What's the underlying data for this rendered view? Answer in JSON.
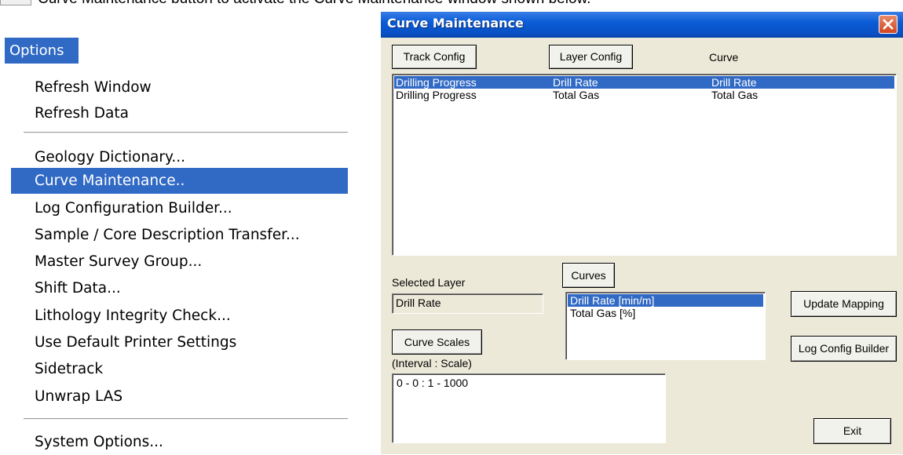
{
  "caption": {
    "text": "Curve Maintenance button to activate the Curve Maintenance window shown below."
  },
  "menu": {
    "title": "Options",
    "items": [
      {
        "label": "Refresh Window"
      },
      {
        "label": "Refresh Data"
      },
      {
        "label": "Geology Dictionary..."
      },
      {
        "label": "Curve Maintenance..",
        "selected": true
      },
      {
        "label": "Log Configuration Builder..."
      },
      {
        "label": "Sample / Core Description Transfer..."
      },
      {
        "label": "Master Survey Group..."
      },
      {
        "label": "Shift Data..."
      },
      {
        "label": "Lithology Integrity Check..."
      },
      {
        "label": "Use Default Printer Settings"
      },
      {
        "label": "Sidetrack"
      },
      {
        "label": "Unwrap LAS"
      },
      {
        "label": "System Options..."
      }
    ]
  },
  "dialog": {
    "title": "Curve Maintenance",
    "track_config_label": "Track Config",
    "layer_config_label": "Layer Config",
    "curve_header": "Curve",
    "mapping_rows": [
      {
        "track": "Drilling Progress",
        "layer": "Drill Rate",
        "curve": "Drill Rate",
        "selected": true
      },
      {
        "track": "Drilling Progress",
        "layer": "Total Gas",
        "curve": "Total Gas",
        "selected": false
      }
    ],
    "selected_layer_label": "Selected Layer",
    "selected_layer_value": "Drill Rate",
    "curves_label": "Curves",
    "curves_list": [
      {
        "label": "Drill Rate [min/m]",
        "selected": true
      },
      {
        "label": "Total Gas [%]",
        "selected": false
      }
    ],
    "update_mapping_label": "Update Mapping",
    "log_config_builder_label": "Log Config Builder",
    "curve_scales_label": "Curve Scales",
    "interval_scale_label": "(Interval : Scale)",
    "scales_list": [
      "0 - 0 : 1 - 1000"
    ],
    "exit_label": "Exit"
  },
  "colors": {
    "selection": "#316ac5",
    "dialog_face": "#ece9d8",
    "titlebar": "#0a5cd6",
    "close_button": "#d2451f"
  }
}
